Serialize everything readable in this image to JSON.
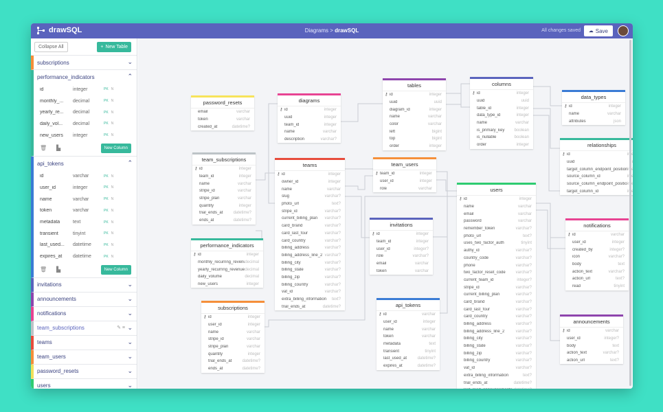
{
  "app": {
    "name": "drawSQL",
    "crumb_root": "Diagrams",
    "crumb_sep": " > ",
    "crumb_current": "drawSQL",
    "saved": "All changes saved",
    "save": "Save"
  },
  "sidebar": {
    "collapse_all": "Collapse All",
    "new_table": "New Table",
    "new_column": "New Column",
    "groups": [
      {
        "name": "subscriptions",
        "color": "#f58f3a",
        "expanded": false
      },
      {
        "name": "performance_indicators",
        "color": "#37b99c",
        "expanded": true,
        "fields": [
          {
            "name": "id",
            "type": "integer",
            "pk": "PK",
            "nn": "N"
          },
          {
            "name": "monthly_...",
            "type": "decimal",
            "pk": "PK",
            "nn": "N"
          },
          {
            "name": "yearly_re...",
            "type": "decimal",
            "pk": "PK",
            "nn": "N"
          },
          {
            "name": "daily_vol...",
            "type": "decimal",
            "pk": "PK",
            "nn": "N"
          },
          {
            "name": "new_users",
            "type": "integer",
            "pk": "PK",
            "nn": "N"
          }
        ]
      },
      {
        "name": "api_tokens",
        "color": "#3a7bd5",
        "expanded": true,
        "fields": [
          {
            "name": "id",
            "type": "varchar",
            "pk": "PK",
            "nn": "N"
          },
          {
            "name": "user_id",
            "type": "integer",
            "pk": "PK",
            "nn": "N"
          },
          {
            "name": "name",
            "type": "varchar",
            "pk": "PK",
            "nn": "N"
          },
          {
            "name": "token",
            "type": "varchar",
            "pk": "PK",
            "nn": "N"
          },
          {
            "name": "metadata",
            "type": "text",
            "pk": "PK",
            "nn": "N"
          },
          {
            "name": "transient",
            "type": "tinyint",
            "pk": "PK",
            "nn": "N"
          },
          {
            "name": "last_used...",
            "type": "datetime",
            "pk": "PK",
            "nn": "N"
          },
          {
            "name": "expires_at",
            "type": "datetime",
            "pk": "PK",
            "nn": "N"
          }
        ]
      },
      {
        "name": "invitations",
        "color": "#5a63bd",
        "expanded": false
      },
      {
        "name": "announcements",
        "color": "#8e44ad",
        "expanded": false
      },
      {
        "name": "notifications",
        "color": "#e84393",
        "expanded": false
      },
      {
        "name": "team_subscriptions",
        "color": "#bdc3c7",
        "expanded": false,
        "active": true
      },
      {
        "name": "teams",
        "color": "#e74c3c",
        "expanded": false
      },
      {
        "name": "team_users",
        "color": "#f58f3a",
        "expanded": false
      },
      {
        "name": "password_resets",
        "color": "#f1e05a",
        "expanded": false
      },
      {
        "name": "users",
        "color": "#2ecc71",
        "expanded": false
      }
    ]
  },
  "tables": [
    {
      "name": "password_resets",
      "color": "#f7e35a",
      "fields": [
        [
          "email",
          "varchar"
        ],
        [
          "token",
          "varchar"
        ],
        [
          "created_at",
          "datetime?"
        ]
      ]
    },
    {
      "name": "diagrams",
      "color": "#e84393",
      "fields": [
        [
          "id",
          "integer"
        ],
        [
          "uuid",
          "integer"
        ],
        [
          "team_id",
          "integer"
        ],
        [
          "name",
          "varchar"
        ],
        [
          "description",
          "varchar?"
        ]
      ]
    },
    {
      "name": "tables",
      "color": "#8e44ad",
      "fields": [
        [
          "id",
          "integer"
        ],
        [
          "uuid",
          "uuid"
        ],
        [
          "diagram_id",
          "integer"
        ],
        [
          "name",
          "varchar"
        ],
        [
          "color",
          "varchar"
        ],
        [
          "left",
          "bigint"
        ],
        [
          "top",
          "bigint"
        ],
        [
          "order",
          "integer"
        ]
      ]
    },
    {
      "name": "columns",
      "color": "#5a63bd",
      "fields": [
        [
          "id",
          "integer"
        ],
        [
          "uuid",
          "uuid"
        ],
        [
          "table_id",
          "integer"
        ],
        [
          "data_type_id",
          "integer"
        ],
        [
          "name",
          "varchar"
        ],
        [
          "is_primary_key",
          "boolean"
        ],
        [
          "is_nullable",
          "boolean"
        ],
        [
          "order",
          "integer"
        ]
      ]
    },
    {
      "name": "data_types",
      "color": "#3a7bd5",
      "fields": [
        [
          "id",
          "integer"
        ],
        [
          "name",
          "varchar"
        ],
        [
          "attributes",
          "json"
        ]
      ]
    },
    {
      "name": "relationships",
      "color": "#37b99c",
      "fields": [
        [
          "id",
          "integer"
        ],
        [
          "uuid",
          "uuid"
        ],
        [
          "target_column_endpoint_position",
          "integer"
        ],
        [
          "source_column_id",
          "integer"
        ],
        [
          "source_column_endpoint_position",
          "integer"
        ],
        [
          "target_column_id",
          "integer"
        ]
      ]
    },
    {
      "name": "team_subscriptions",
      "color": "#bdc3c7",
      "fields": [
        [
          "id",
          "integer"
        ],
        [
          "team_id",
          "integer"
        ],
        [
          "name",
          "varchar"
        ],
        [
          "stripe_id",
          "varchar"
        ],
        [
          "stripe_plan",
          "varchar"
        ],
        [
          "quantity",
          "integer"
        ],
        [
          "trial_ends_at",
          "datetime?"
        ],
        [
          "ends_at",
          "datetime?"
        ]
      ]
    },
    {
      "name": "teams",
      "color": "#e74c3c",
      "fields": [
        [
          "id",
          "integer"
        ],
        [
          "owner_id",
          "integer"
        ],
        [
          "name",
          "varchar"
        ],
        [
          "slug",
          "varchar?"
        ],
        [
          "photo_url",
          "text?"
        ],
        [
          "stripe_id",
          "varchar?"
        ],
        [
          "current_billing_plan",
          "varchar?"
        ],
        [
          "card_brand",
          "varchar?"
        ],
        [
          "card_last_four",
          "varchar?"
        ],
        [
          "card_country",
          "varchar?"
        ],
        [
          "billing_address",
          "varchar?"
        ],
        [
          "billing_address_line_2",
          "varchar?"
        ],
        [
          "billing_city",
          "varchar?"
        ],
        [
          "billing_state",
          "varchar?"
        ],
        [
          "billing_zip",
          "varchar?"
        ],
        [
          "billing_country",
          "varchar?"
        ],
        [
          "vat_id",
          "varchar?"
        ],
        [
          "extra_billing_information",
          "text?"
        ],
        [
          "trial_ends_at",
          "datetime?"
        ]
      ]
    },
    {
      "name": "team_users",
      "color": "#f58f3a",
      "fields": [
        [
          "team_id",
          "integer"
        ],
        [
          "user_id",
          "integer"
        ],
        [
          "role",
          "varchar"
        ]
      ]
    },
    {
      "name": "users",
      "color": "#2ecc71",
      "fields": [
        [
          "id",
          "integer"
        ],
        [
          "name",
          "varchar"
        ],
        [
          "email",
          "varchar"
        ],
        [
          "password",
          "varchar"
        ],
        [
          "remember_token",
          "varchar?"
        ],
        [
          "photo_url",
          "text?"
        ],
        [
          "uses_two_factor_auth",
          "tinyint"
        ],
        [
          "authy_id",
          "varchar?"
        ],
        [
          "country_code",
          "varchar?"
        ],
        [
          "phone",
          "varchar?"
        ],
        [
          "two_factor_reset_code",
          "varchar?"
        ],
        [
          "current_team_id",
          "integer?"
        ],
        [
          "stripe_id",
          "varchar?"
        ],
        [
          "current_billing_plan",
          "varchar?"
        ],
        [
          "card_brand",
          "varchar?"
        ],
        [
          "card_last_four",
          "varchar?"
        ],
        [
          "card_country",
          "varchar?"
        ],
        [
          "billing_address",
          "varchar?"
        ],
        [
          "billing_address_line_2",
          "varchar?"
        ],
        [
          "billing_city",
          "varchar?"
        ],
        [
          "billing_state",
          "varchar?"
        ],
        [
          "billing_zip",
          "varchar?"
        ],
        [
          "billing_country",
          "varchar?"
        ],
        [
          "vat_id",
          "varchar?"
        ],
        [
          "extra_billing_information",
          "text?"
        ],
        [
          "trial_ends_at",
          "datetime?"
        ],
        [
          "last_read_announcements_at",
          "datetime?"
        ]
      ]
    },
    {
      "name": "invitations",
      "color": "#5a63bd",
      "fields": [
        [
          "id",
          "integer"
        ],
        [
          "team_id",
          "integer"
        ],
        [
          "user_id",
          "integer?"
        ],
        [
          "role",
          "varchar?"
        ],
        [
          "email",
          "varchar"
        ],
        [
          "token",
          "varchar"
        ]
      ]
    },
    {
      "name": "performance_indicators",
      "color": "#37b99c",
      "fields": [
        [
          "id",
          "integer"
        ],
        [
          "monthly_recurring_revenue",
          "decimal"
        ],
        [
          "yearly_recurring_revenue",
          "decimal"
        ],
        [
          "daily_volume",
          "decimal"
        ],
        [
          "new_users",
          "integer"
        ]
      ]
    },
    {
      "name": "notifications",
      "color": "#e84393",
      "fields": [
        [
          "id",
          "varchar"
        ],
        [
          "user_id",
          "integer"
        ],
        [
          "created_by",
          "integer?"
        ],
        [
          "icon",
          "varchar?"
        ],
        [
          "body",
          "text"
        ],
        [
          "action_text",
          "varchar?"
        ],
        [
          "action_url",
          "text?"
        ],
        [
          "read",
          "tinyint"
        ]
      ]
    },
    {
      "name": "subscriptions",
      "color": "#f58f3a",
      "fields": [
        [
          "id",
          "integer"
        ],
        [
          "user_id",
          "integer"
        ],
        [
          "name",
          "varchar"
        ],
        [
          "stripe_id",
          "varchar"
        ],
        [
          "stripe_plan",
          "varchar"
        ],
        [
          "quantity",
          "integer"
        ],
        [
          "trial_ends_at",
          "datetime?"
        ],
        [
          "ends_at",
          "datetime?"
        ]
      ]
    },
    {
      "name": "api_tokens",
      "color": "#3a7bd5",
      "fields": [
        [
          "id",
          "varchar"
        ],
        [
          "user_id",
          "integer"
        ],
        [
          "name",
          "varchar"
        ],
        [
          "token",
          "varchar"
        ],
        [
          "metadata",
          "text"
        ],
        [
          "transient",
          "tinyint"
        ],
        [
          "last_used_at",
          "datetime?"
        ],
        [
          "expires_at",
          "datetime?"
        ]
      ]
    },
    {
      "name": "announcements",
      "color": "#8e44ad",
      "fields": [
        [
          "id",
          "varchar"
        ],
        [
          "user_id",
          "integer?"
        ],
        [
          "body",
          "text"
        ],
        [
          "action_text",
          "varchar?"
        ],
        [
          "action_url",
          "text?"
        ]
      ]
    }
  ]
}
